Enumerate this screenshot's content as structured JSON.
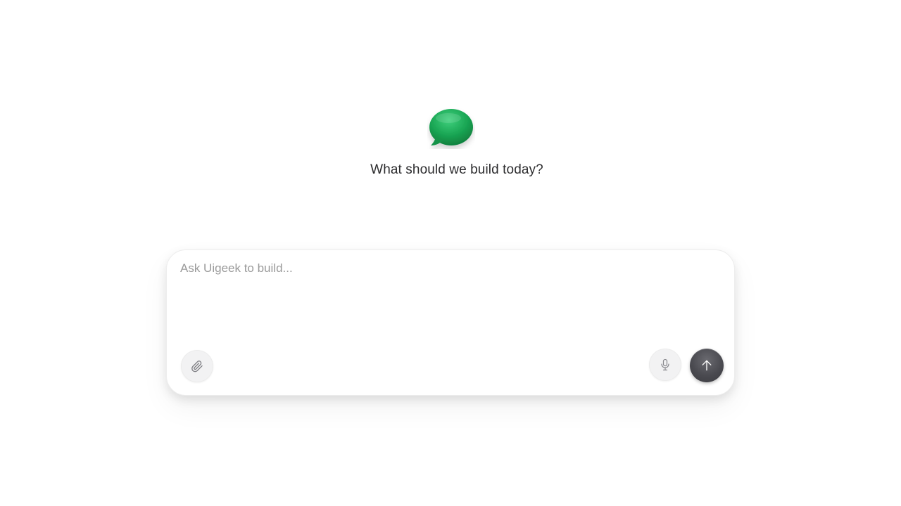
{
  "hero": {
    "logo_icon": "chat-bubble-icon",
    "logo_color": "#1fae5b",
    "heading": "What should we build today?"
  },
  "composer": {
    "placeholder": "Ask Uigeek to build...",
    "value": "",
    "attach_icon": "paperclip-icon",
    "mic_icon": "microphone-icon",
    "send_icon": "arrow-up-icon",
    "send_color": "#4a4a50"
  }
}
